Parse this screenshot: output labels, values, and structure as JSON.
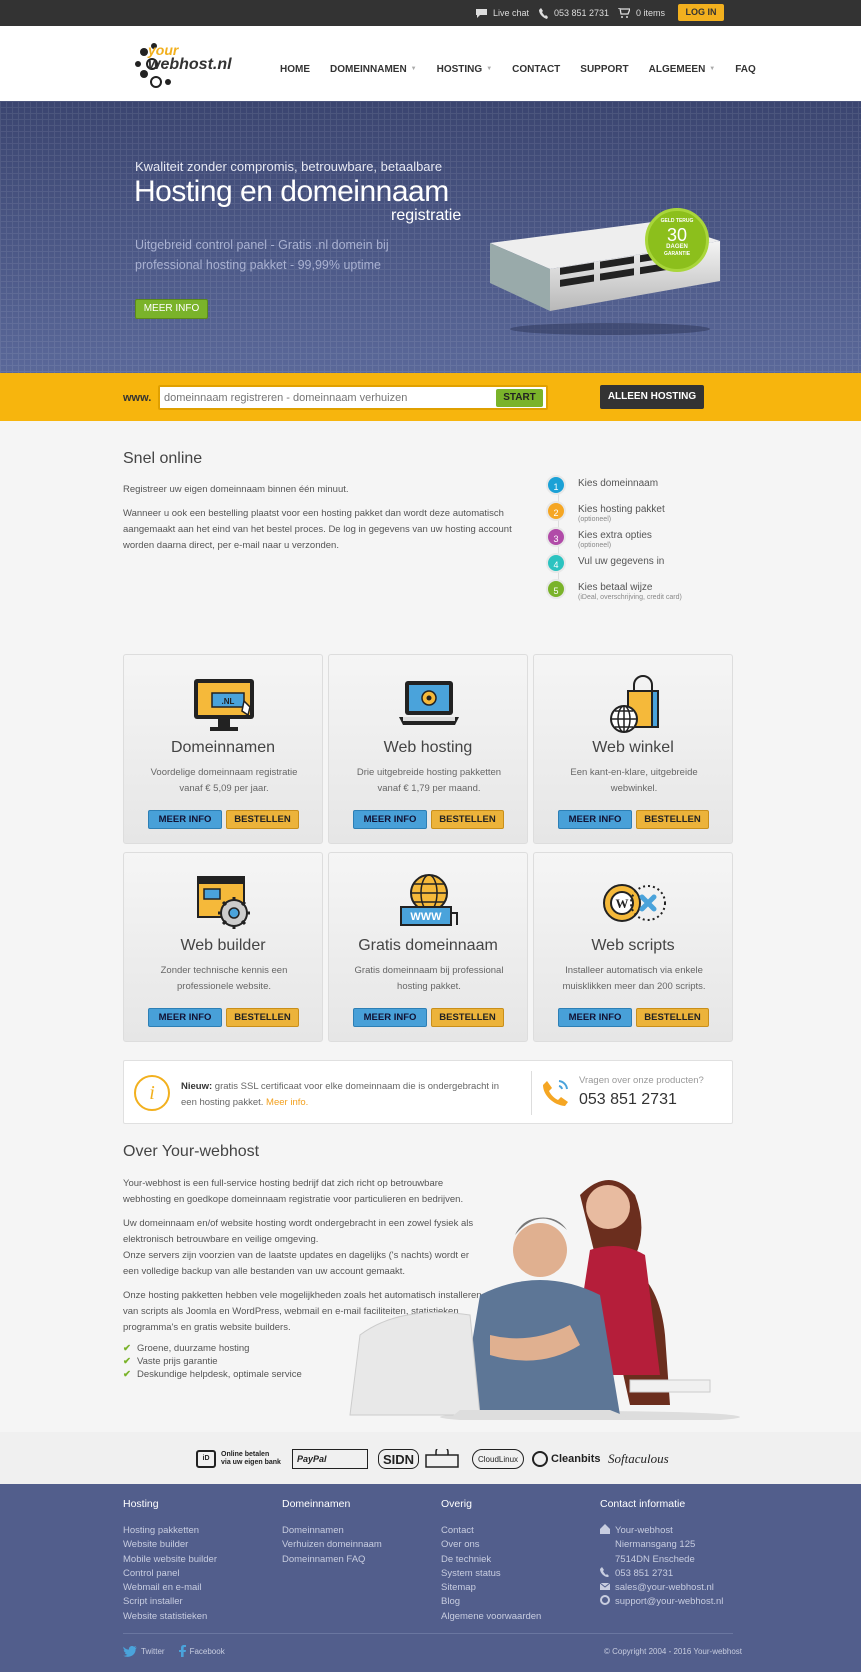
{
  "topbar": {
    "live_chat": "Live chat",
    "phone": "053 851 2731",
    "cart": "0 items",
    "login": "LOG IN"
  },
  "header": {
    "logo_line1": "your",
    "logo_line2": "webhost.nl",
    "nav": [
      {
        "label": "HOME"
      },
      {
        "label": "DOMEINNAMEN"
      },
      {
        "label": "HOSTING"
      },
      {
        "label": "CONTACT"
      },
      {
        "label": "SUPPORT"
      },
      {
        "label": "ALGEMEEN"
      },
      {
        "label": "FAQ"
      }
    ]
  },
  "hero": {
    "subtitle": "Kwaliteit zonder compromis, betrouwbare, betaalbare",
    "title": "Hosting en domeinnaam",
    "title2": "registratie",
    "description": "Uitgebreid control panel - Gratis .nl domein bij professional hosting pakket - 99,99% uptime",
    "button": "MEER INFO",
    "badge_top": "GELD TERUG",
    "badge_num": "30",
    "badge_days": "DAGEN",
    "badge_bottom": "GARANTIE"
  },
  "search": {
    "prefix": "www.",
    "placeholder": "domeinnaam registreren - domeinnaam verhuizen",
    "start": "START",
    "hosting_only": "ALLEEN HOSTING"
  },
  "snel": {
    "title": "Snel online",
    "p1": "Registreer uw eigen domeinnaam binnen één minuut.",
    "p2": "Wanneer u ook een bestelling plaatst voor een hosting pakket dan wordt deze automatisch aangemaakt aan het eind van het bestel proces. De log in gegevens van uw hosting account worden daarna direct, per e-mail naar u verzonden.",
    "steps": [
      {
        "num": "1",
        "label": "Kies domeinnaam",
        "note": "",
        "color": "#1ba1d6"
      },
      {
        "num": "2",
        "label": "Kies hosting pakket",
        "note": "(optioneel)",
        "color": "#f5a623"
      },
      {
        "num": "3",
        "label": "Kies extra opties",
        "note": "(optioneel)",
        "color": "#b14ba8"
      },
      {
        "num": "4",
        "label": "Vul uw gegevens in",
        "note": "",
        "color": "#2cc3c0"
      },
      {
        "num": "5",
        "label": "Kies betaal wijze",
        "note": "(iDeal, overschrijving, credit card)",
        "color": "#7ab32a"
      }
    ]
  },
  "cards": [
    {
      "title": "Domeinnamen",
      "desc": "Voordelige domeinnaam registratie vanaf € 5,09 per jaar.",
      "icon": "nl-monitor-icon",
      "more": "MEER INFO",
      "order": "BESTELLEN"
    },
    {
      "title": "Web hosting",
      "desc": "Drie uitgebreide hosting pakketten vanaf € 1,79 per maand.",
      "icon": "laptop-gear-icon",
      "more": "MEER INFO",
      "order": "BESTELLEN"
    },
    {
      "title": "Web winkel",
      "desc": "Een kant-en-klare, uitgebreide webwinkel.",
      "icon": "shopping-bag-globe-icon",
      "more": "MEER INFO",
      "order": "BESTELLEN"
    },
    {
      "title": "Web builder",
      "desc": "Zonder technische kennis een professionele website.",
      "icon": "window-gear-icon",
      "more": "MEER INFO",
      "order": "BESTELLEN"
    },
    {
      "title": "Gratis domeinnaam",
      "desc": "Gratis domeinnaam bij professional hosting pakket.",
      "icon": "globe-www-icon",
      "more": "MEER INFO",
      "order": "BESTELLEN"
    },
    {
      "title": "Web scripts",
      "desc": "Installeer automatisch via enkele muisklikken meer dan 200 scripts.",
      "icon": "wordpress-joomla-icon",
      "more": "MEER INFO",
      "order": "BESTELLEN"
    }
  ],
  "info": {
    "new_label": "Nieuw:",
    "text": " gratis SSL certificaat voor elke domeinnaam die is ondergebracht in een hosting pakket. ",
    "link": "Meer info.",
    "question": "Vragen over onze producten?",
    "phone": "053 851 2731"
  },
  "over": {
    "title": "Over Your-webhost",
    "p1": "Your-webhost is een full-service hosting bedrijf dat zich richt op betrouwbare webhosting en goedkope domeinnaam registratie voor particulieren en bedrijven.",
    "p2": "Uw domeinnaam en/of website hosting wordt ondergebracht in een zowel fysiek als elektronisch betrouwbare en veilige omgeving.",
    "p3": "Onze servers zijn voorzien van de laatste updates en dagelijks ('s nachts) wordt er een volledige backup van alle bestanden van uw account gemaakt.",
    "p4": "Onze hosting pakketten hebben vele mogelijkheden zoals het automatisch installeren van scripts als Joomla en WordPress, webmail en e-mail faciliteiten, statistieken programma's en gratis website builders.",
    "checks": [
      "Groene, duurzame hosting",
      "Vaste prijs garantie",
      "Deskundige helpdesk, optimale service"
    ]
  },
  "partners": {
    "ideal_line1": "Online betalen",
    "ideal_line2": "via uw eigen bank",
    "paypal": "PayPal",
    "sidn": "SIDN",
    "cloudlinux": "CloudLinux",
    "cleanbits": "Cleanbits",
    "softaculous": "Softaculous"
  },
  "footer": {
    "hosting": {
      "title": "Hosting",
      "links": [
        "Hosting pakketten",
        "Website builder",
        "Mobile website builder",
        "Control panel",
        "Webmail en e-mail",
        "Script installer",
        "Website statistieken"
      ]
    },
    "domeinnamen": {
      "title": "Domeinnamen",
      "links": [
        "Domeinnamen",
        "Verhuizen domeinnaam",
        "Domeinnamen FAQ"
      ]
    },
    "overig": {
      "title": "Overig",
      "links": [
        "Contact",
        "Over ons",
        "De techniek",
        "System status",
        "Sitemap",
        "Blog",
        "Algemene voorwaarden"
      ]
    },
    "contact": {
      "title": "Contact informatie",
      "company": "Your-webhost",
      "street": "Niermansgang 125",
      "city": "7514DN Enschede",
      "phone": "053 851 2731",
      "sales": "sales@your-webhost.nl",
      "support": "support@your-webhost.nl"
    },
    "twitter": "Twitter",
    "facebook": "Facebook",
    "copyright": "© Copyright 2004 - 2016 Your-webhost"
  }
}
